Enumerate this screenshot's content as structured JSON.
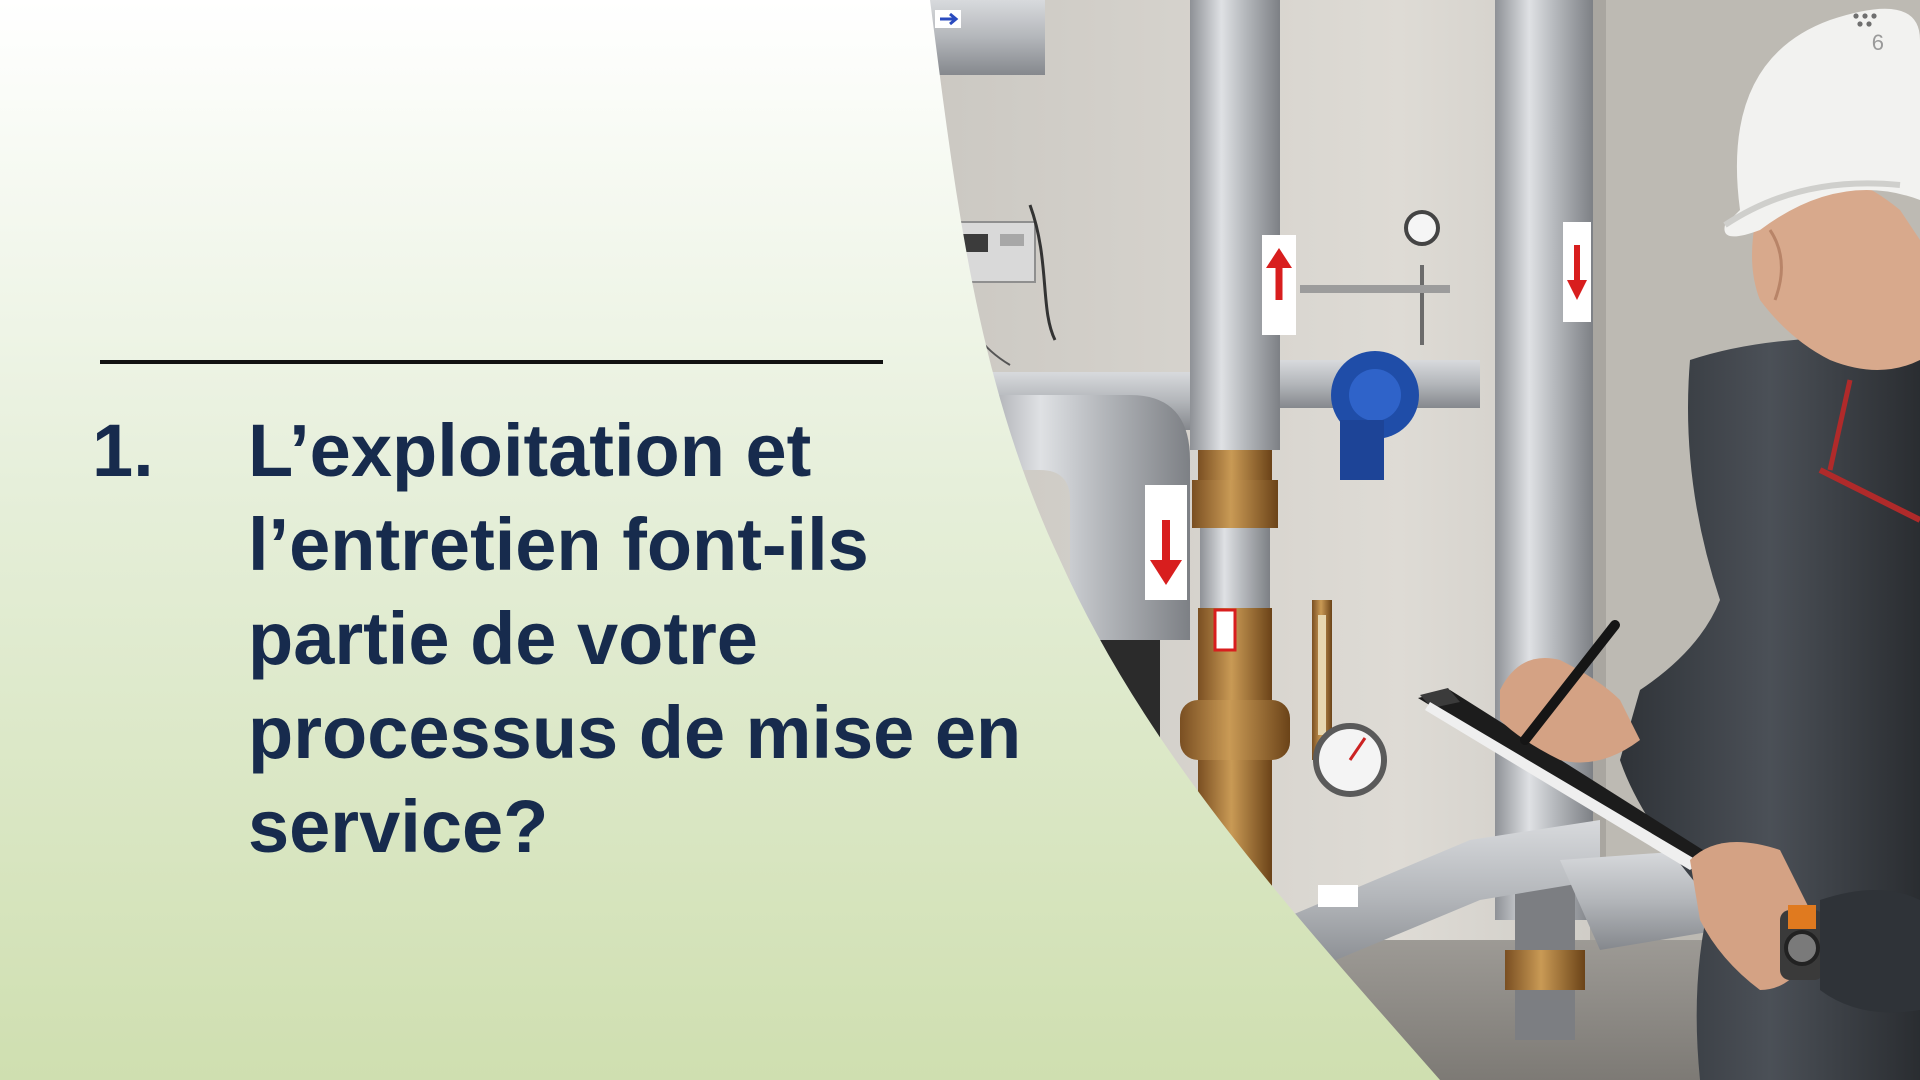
{
  "slide": {
    "number": "1.",
    "question": "L’exploitation et l’entretien font-ils partie de votre processus de mise en service?",
    "page_number": "6"
  },
  "colors": {
    "title": "#172b4d",
    "panel_top": "#ffffff",
    "panel_bottom": "#cfdfb0",
    "rule": "#111111"
  },
  "photo": {
    "subject": "technician in white hard hat writing on clipboard beside insulated pipes and valves",
    "icons": [
      "arrow-up-icon",
      "arrow-down-icon",
      "pressure-gauge-icon",
      "valve-icon",
      "hard-hat-icon",
      "pen-icon",
      "clipboard-icon"
    ]
  }
}
